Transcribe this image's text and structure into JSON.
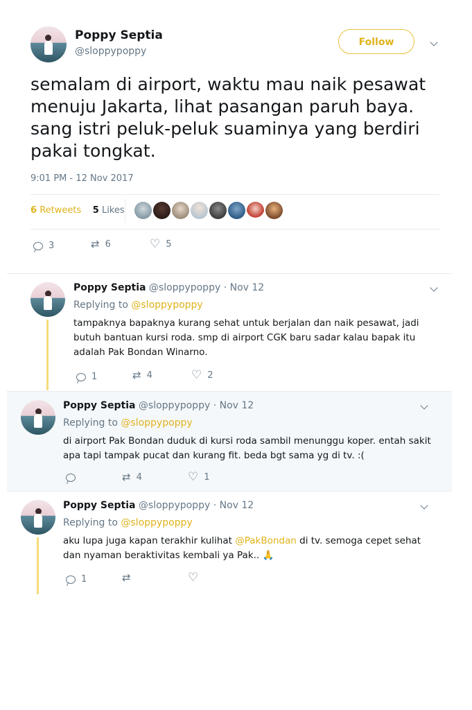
{
  "tweet": {
    "name": "Poppy Septia",
    "handle": "@sloppypoppy",
    "follow_label": "Follow",
    "text": "semalam di airport, waktu mau naik pesawat menuju Jakarta, lihat pasangan paruh baya. sang istri peluk-peluk suaminya yang berdiri pakai tongkat.",
    "timestamp": "9:01 PM - 12 Nov 2017",
    "retweets_count": "6",
    "retweets_label": "Retweets",
    "likes_count": "5",
    "likes_label": "Likes",
    "reply_count": "3",
    "retweet_count": "6",
    "like_count": "5"
  },
  "replies": [
    {
      "name": "Poppy Septia",
      "handle": "@sloppypoppy",
      "date": "· Nov 12",
      "replying_prefix": "Replying to",
      "replying_to": "@sloppypoppy",
      "text": "tampaknya bapaknya kurang sehat untuk berjalan dan naik pesawat, jadi butuh bantuan kursi roda. smp di airport CGK baru sadar kalau bapak itu adalah Pak Bondan Winarno.",
      "reply_count": "1",
      "retweet_count": "4",
      "like_count": "2"
    },
    {
      "name": "Poppy Septia",
      "handle": "@sloppypoppy",
      "date": "· Nov 12",
      "replying_prefix": "Replying to",
      "replying_to": "@sloppypoppy",
      "text": "di airport Pak Bondan duduk di kursi roda sambil menunggu koper. entah sakit apa tapi tampak pucat dan kurang fit. beda bgt sama yg di tv. :(",
      "reply_count": "",
      "retweet_count": "4",
      "like_count": "1"
    },
    {
      "name": "Poppy Septia",
      "handle": "@sloppypoppy",
      "date": "· Nov 12",
      "replying_prefix": "Replying to",
      "replying_to": "@sloppypoppy",
      "text_before": "aku lupa juga kapan terakhir kulihat ",
      "mention": "@PakBondan",
      "text_after": " di tv. semoga cepet sehat dan nyaman beraktivitas kembali ya Pak.. 🙏",
      "reply_count": "1",
      "retweet_count": "",
      "like_count": ""
    }
  ],
  "colors": {
    "accent": "#e0b21c",
    "thread_line": "#f3dc7a",
    "muted": "#657786",
    "highlight_bg": "#f5f8fa"
  }
}
